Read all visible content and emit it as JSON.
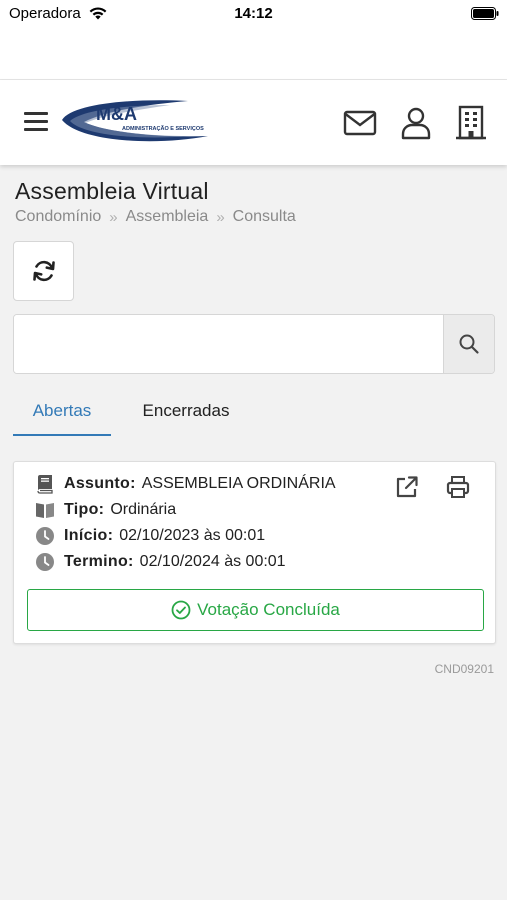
{
  "status_bar": {
    "carrier": "Operadora",
    "time": "14:12"
  },
  "header": {
    "logo_text": "M&A",
    "logo_subtitle": "ADMINISTRAÇÃO E SERVIÇOS",
    "icons": [
      "menu-icon",
      "mail-icon",
      "user-icon",
      "building-icon"
    ]
  },
  "page": {
    "title": "Assembleia Virtual",
    "breadcrumb": [
      "Condomínio",
      "Assembleia",
      "Consulta"
    ]
  },
  "search": {
    "value": "",
    "placeholder": ""
  },
  "tabs": [
    {
      "label": "Abertas",
      "active": true
    },
    {
      "label": "Encerradas",
      "active": false
    }
  ],
  "assembly": {
    "assunto_label": "Assunto:",
    "assunto_value": "ASSEMBLEIA ORDINÁRIA",
    "tipo_label": "Tipo:",
    "tipo_value": "Ordinária",
    "inicio_label": "Início:",
    "inicio_value": "02/10/2023 às 00:01",
    "termino_label": "Termino:",
    "termino_value": "02/10/2024 às 00:01",
    "status": "Votação Concluída"
  },
  "screen_code": "CND09201",
  "colors": {
    "accent": "#337ab7",
    "success": "#28a745",
    "logo_blue": "#1e3a70"
  }
}
